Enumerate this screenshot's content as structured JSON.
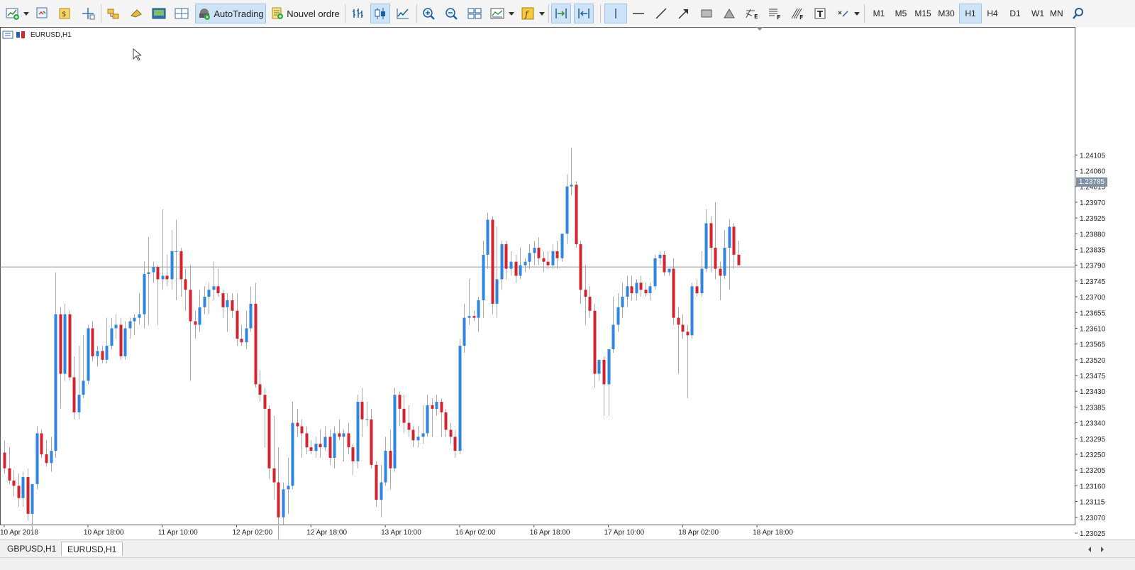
{
  "toolbar": {
    "autotrading_label": "AutoTrading",
    "new_order_label": "Nouvel ordre",
    "timeframes": [
      "M1",
      "M5",
      "M15",
      "M30",
      "H1",
      "H4",
      "D1",
      "W1",
      "MN"
    ],
    "active_timeframe": "H1",
    "icons": [
      "new-chart-icon",
      "profiles-icon",
      "market-watch-icon",
      "data-window-icon",
      "navigator-icon",
      "terminal-icon",
      "strategy-tester-icon",
      "autotrading-icon",
      "new-order-icon",
      "bar-chart-icon",
      "candlestick-icon",
      "line-chart-icon",
      "zoom-in-icon",
      "zoom-out-icon",
      "tile-windows-icon",
      "periods-icon",
      "indicators-icon",
      "chart-shift-icon",
      "auto-scroll-icon",
      "crosshair-icon",
      "vertical-line-icon",
      "horizontal-line-icon",
      "trendline-icon",
      "arrow-icon",
      "rectangle-icon",
      "triangle-icon",
      "fibonacci-expansion-icon",
      "fibonacci-fan-icon",
      "text-icon",
      "more-objects-icon",
      "search-icon"
    ]
  },
  "chart": {
    "title": "EURUSD,H1",
    "current_price_label": "1.23785"
  },
  "tabs": [
    "GBPUSD,H1",
    "EURUSD,H1"
  ],
  "active_tab": "EURUSD,H1",
  "colors": {
    "bull": "#2f86e0",
    "bear": "#d4232e",
    "wick": "#a8a8a8",
    "bidline": "#8a96a8"
  },
  "chart_data": {
    "type": "candlestick",
    "symbol": "EURUSD",
    "timeframe": "H1",
    "ylim": [
      1.23,
      1.2413
    ],
    "y_ticks": [
      "1.24105",
      "1.24060",
      "1.24015",
      "1.23970",
      "1.23925",
      "1.23880",
      "1.23835",
      "1.23790",
      "1.23745",
      "1.23700",
      "1.23655",
      "1.23610",
      "1.23565",
      "1.23520",
      "1.23475",
      "1.23430",
      "1.23385",
      "1.23340",
      "1.23295",
      "1.23250",
      "1.23205",
      "1.23160",
      "1.23115",
      "1.23070",
      "1.23025"
    ],
    "x_ticks": [
      {
        "label": "10 Apr 2018",
        "index": 0
      },
      {
        "label": "10 Apr 18:00",
        "index": 18
      },
      {
        "label": "11 Apr 10:00",
        "index": 34
      },
      {
        "label": "12 Apr 02:00",
        "index": 50
      },
      {
        "label": "12 Apr 18:00",
        "index": 66
      },
      {
        "label": "13 Apr 10:00",
        "index": 82
      },
      {
        "label": "16 Apr 02:00",
        "index": 98
      },
      {
        "label": "16 Apr 18:00",
        "index": 114
      },
      {
        "label": "17 Apr 10:00",
        "index": 130
      },
      {
        "label": "18 Apr 02:00",
        "index": 146
      },
      {
        "label": "18 Apr 18:00",
        "index": 162
      }
    ],
    "current_price": 1.23785,
    "candles": [
      [
        1.23255,
        1.2329,
        1.23195,
        1.2321
      ],
      [
        1.2321,
        1.2327,
        1.23165,
        1.23175
      ],
      [
        1.23175,
        1.23205,
        1.2313,
        1.2316
      ],
      [
        1.2316,
        1.23195,
        1.231,
        1.23125
      ],
      [
        1.23125,
        1.232,
        1.231,
        1.23185
      ],
      [
        1.23185,
        1.2321,
        1.2306,
        1.2308
      ],
      [
        1.2308,
        1.2316,
        1.2303,
        1.23165
      ],
      [
        1.23165,
        1.2333,
        1.2315,
        1.2331
      ],
      [
        1.2331,
        1.2332,
        1.2324,
        1.2325
      ],
      [
        1.2325,
        1.2329,
        1.23215,
        1.23225
      ],
      [
        1.23225,
        1.233,
        1.232,
        1.2326
      ],
      [
        1.2326,
        1.2377,
        1.2324,
        1.2365
      ],
      [
        1.2365,
        1.2367,
        1.2338,
        1.2348
      ],
      [
        1.2348,
        1.2368,
        1.2346,
        1.2365
      ],
      [
        1.2365,
        1.2366,
        1.2346,
        1.2347
      ],
      [
        1.2347,
        1.2353,
        1.2335,
        1.2337
      ],
      [
        1.2337,
        1.2356,
        1.2335,
        1.2342
      ],
      [
        1.2342,
        1.2359,
        1.2341,
        1.2346
      ],
      [
        1.2346,
        1.2362,
        1.2345,
        1.2361
      ],
      [
        1.2361,
        1.2363,
        1.23515,
        1.2353
      ],
      [
        1.2353,
        1.2356,
        1.235,
        1.23545
      ],
      [
        1.23545,
        1.2356,
        1.2351,
        1.2352
      ],
      [
        1.2352,
        1.2364,
        1.2351,
        1.2356
      ],
      [
        1.2356,
        1.2364,
        1.2355,
        1.2361
      ],
      [
        1.2361,
        1.2365,
        1.2358,
        1.2362
      ],
      [
        1.2362,
        1.2364,
        1.2352,
        1.2353
      ],
      [
        1.2353,
        1.2363,
        1.2352,
        1.2361
      ],
      [
        1.2361,
        1.2364,
        1.2358,
        1.2363
      ],
      [
        1.2363,
        1.2365,
        1.2359,
        1.2364
      ],
      [
        1.2364,
        1.2371,
        1.2362,
        1.2365
      ],
      [
        1.2365,
        1.238,
        1.2361,
        1.23765
      ],
      [
        1.23765,
        1.2387,
        1.2362,
        1.2377
      ],
      [
        1.2377,
        1.238,
        1.2374,
        1.23785
      ],
      [
        1.23785,
        1.2379,
        1.2362,
        1.2375
      ],
      [
        1.2375,
        1.2395,
        1.2372,
        1.2376
      ],
      [
        1.2376,
        1.2382,
        1.2373,
        1.2375
      ],
      [
        1.2375,
        1.2389,
        1.2372,
        1.2383
      ],
      [
        1.2383,
        1.2392,
        1.2369,
        1.2383
      ],
      [
        1.2383,
        1.2384,
        1.237,
        1.2375
      ],
      [
        1.2375,
        1.2378,
        1.2366,
        1.2372
      ],
      [
        1.2372,
        1.2379,
        1.2346,
        1.2363
      ],
      [
        1.2363,
        1.2366,
        1.2358,
        1.2362
      ],
      [
        1.2362,
        1.2372,
        1.236,
        1.2367
      ],
      [
        1.2367,
        1.2373,
        1.2365,
        1.237
      ],
      [
        1.237,
        1.2374,
        1.2365,
        1.2372
      ],
      [
        1.2372,
        1.238,
        1.2369,
        1.2373
      ],
      [
        1.2373,
        1.2378,
        1.237,
        1.2371
      ],
      [
        1.2371,
        1.2372,
        1.2364,
        1.2367
      ],
      [
        1.2367,
        1.2371,
        1.236,
        1.2369
      ],
      [
        1.2369,
        1.2371,
        1.2364,
        1.2366
      ],
      [
        1.2366,
        1.2371,
        1.2356,
        1.2358
      ],
      [
        1.2358,
        1.2362,
        1.2356,
        1.2357
      ],
      [
        1.2357,
        1.2366,
        1.2355,
        1.2361
      ],
      [
        1.2361,
        1.2373,
        1.236,
        1.2368
      ],
      [
        1.2368,
        1.2374,
        1.2344,
        1.2345
      ],
      [
        1.2345,
        1.2349,
        1.234,
        1.2342
      ],
      [
        1.2342,
        1.2344,
        1.2327,
        1.2338
      ],
      [
        1.2338,
        1.2339,
        1.2318,
        1.2321
      ],
      [
        1.2321,
        1.2336,
        1.2312,
        1.2317
      ],
      [
        1.2317,
        1.2327,
        1.23,
        1.2307
      ],
      [
        1.2307,
        1.2317,
        1.2305,
        1.2315
      ],
      [
        1.2315,
        1.2324,
        1.2308,
        1.2316
      ],
      [
        1.2316,
        1.234,
        1.2315,
        1.2334
      ],
      [
        1.2334,
        1.2338,
        1.233,
        1.2333
      ],
      [
        1.2333,
        1.2335,
        1.2324,
        1.2331
      ],
      [
        1.2331,
        1.2333,
        1.2325,
        1.2327
      ],
      [
        1.2327,
        1.2329,
        1.2325,
        1.2326
      ],
      [
        1.2326,
        1.233,
        1.2324,
        1.2328
      ],
      [
        1.2328,
        1.2332,
        1.2324,
        1.2327
      ],
      [
        1.2327,
        1.2333,
        1.2326,
        1.233
      ],
      [
        1.233,
        1.2332,
        1.2322,
        1.2324
      ],
      [
        1.2324,
        1.2333,
        1.2321,
        1.2331
      ],
      [
        1.2331,
        1.2335,
        1.2329,
        1.233
      ],
      [
        1.233,
        1.2332,
        1.2323,
        1.2331
      ],
      [
        1.2331,
        1.2334,
        1.2325,
        1.2327
      ],
      [
        1.2327,
        1.2328,
        1.2319,
        1.2323
      ],
      [
        1.2323,
        1.2342,
        1.2321,
        1.234
      ],
      [
        1.234,
        1.2344,
        1.233,
        1.2335
      ],
      [
        1.2335,
        1.234,
        1.2333,
        1.2335
      ],
      [
        1.2335,
        1.2338,
        1.2321,
        1.2322
      ],
      [
        1.2322,
        1.2323,
        1.231,
        1.2312
      ],
      [
        1.2312,
        1.2322,
        1.2307,
        1.2317
      ],
      [
        1.2317,
        1.233,
        1.2316,
        1.2326
      ],
      [
        1.2326,
        1.2332,
        1.2315,
        1.2321
      ],
      [
        1.2321,
        1.2344,
        1.232,
        1.2342
      ],
      [
        1.2342,
        1.2343,
        1.2333,
        1.2338
      ],
      [
        1.2338,
        1.2342,
        1.2331,
        1.2334
      ],
      [
        1.2334,
        1.2339,
        1.233,
        1.2332
      ],
      [
        1.2332,
        1.2333,
        1.2327,
        1.2329
      ],
      [
        1.2329,
        1.2333,
        1.2327,
        1.233
      ],
      [
        1.233,
        1.2339,
        1.2328,
        1.2331
      ],
      [
        1.2331,
        1.2342,
        1.233,
        1.2339
      ],
      [
        1.2339,
        1.2341,
        1.233,
        1.2338
      ],
      [
        1.2338,
        1.2342,
        1.2336,
        1.234
      ],
      [
        1.234,
        1.2341,
        1.233,
        1.2337
      ],
      [
        1.2337,
        1.2338,
        1.233,
        1.2332
      ],
      [
        1.2332,
        1.2334,
        1.2328,
        1.233
      ],
      [
        1.233,
        1.2332,
        1.2324,
        1.2326
      ],
      [
        1.2326,
        1.2358,
        1.2325,
        1.2356
      ],
      [
        1.2356,
        1.2368,
        1.2354,
        1.2364
      ],
      [
        1.2364,
        1.2375,
        1.2362,
        1.23645
      ],
      [
        1.23645,
        1.2366,
        1.2363,
        1.2364
      ],
      [
        1.2364,
        1.237,
        1.236,
        1.2369
      ],
      [
        1.2369,
        1.2386,
        1.2364,
        1.2382
      ],
      [
        1.2382,
        1.2394,
        1.2378,
        1.2392
      ],
      [
        1.2392,
        1.2393,
        1.2365,
        1.2368
      ],
      [
        1.2368,
        1.239,
        1.2364,
        1.2375
      ],
      [
        1.2375,
        1.2386,
        1.2372,
        1.2385
      ],
      [
        1.2385,
        1.2386,
        1.2375,
        1.2378
      ],
      [
        1.2378,
        1.2383,
        1.2376,
        1.238
      ],
      [
        1.238,
        1.2382,
        1.2374,
        1.2376
      ],
      [
        1.2376,
        1.2384,
        1.2375,
        1.2379
      ],
      [
        1.2379,
        1.2381,
        1.2377,
        1.238
      ],
      [
        1.238,
        1.2385,
        1.2378,
        1.23825
      ],
      [
        1.23825,
        1.2386,
        1.2379,
        1.2384
      ],
      [
        1.2384,
        1.2387,
        1.2379,
        1.2381
      ],
      [
        1.2381,
        1.2383,
        1.2377,
        1.238
      ],
      [
        1.238,
        1.2383,
        1.2378,
        1.2379
      ],
      [
        1.2379,
        1.2385,
        1.2378,
        1.2383
      ],
      [
        1.2383,
        1.2386,
        1.2378,
        1.2381
      ],
      [
        1.2381,
        1.2388,
        1.238,
        1.2388
      ],
      [
        1.2388,
        1.2405,
        1.2385,
        1.24015
      ],
      [
        1.24015,
        1.24125,
        1.2399,
        1.2402
      ],
      [
        1.2402,
        1.2403,
        1.2384,
        1.2385
      ],
      [
        1.2385,
        1.2386,
        1.2368,
        1.2372
      ],
      [
        1.2372,
        1.2379,
        1.2362,
        1.237
      ],
      [
        1.237,
        1.2373,
        1.2364,
        1.2366
      ],
      [
        1.2366,
        1.2368,
        1.2344,
        1.2348
      ],
      [
        1.2348,
        1.2352,
        1.2346,
        1.2352
      ],
      [
        1.2352,
        1.2353,
        1.2336,
        1.2345
      ],
      [
        1.2345,
        1.2353,
        1.2336,
        1.2355
      ],
      [
        1.2355,
        1.237,
        1.2354,
        1.2362
      ],
      [
        1.2362,
        1.2371,
        1.236,
        1.2367
      ],
      [
        1.2367,
        1.2374,
        1.2364,
        1.237
      ],
      [
        1.237,
        1.2376,
        1.2367,
        1.2373
      ],
      [
        1.2373,
        1.2376,
        1.2369,
        1.2371
      ],
      [
        1.2371,
        1.2375,
        1.2369,
        1.2374
      ],
      [
        1.2374,
        1.2376,
        1.237,
        1.2372
      ],
      [
        1.2372,
        1.2374,
        1.237,
        1.2371
      ],
      [
        1.2371,
        1.2374,
        1.2369,
        1.2373
      ],
      [
        1.2373,
        1.2382,
        1.2372,
        1.2381
      ],
      [
        1.2381,
        1.2383,
        1.2379,
        1.2382
      ],
      [
        1.2382,
        1.2383,
        1.2376,
        1.2377
      ],
      [
        1.2377,
        1.2378,
        1.2376,
        1.2378
      ],
      [
        1.2378,
        1.2381,
        1.2362,
        1.2364
      ],
      [
        1.2364,
        1.2367,
        1.2348,
        1.2362
      ],
      [
        1.2362,
        1.2365,
        1.2358,
        1.236
      ],
      [
        1.236,
        1.2362,
        1.2341,
        1.2359
      ],
      [
        1.2359,
        1.2374,
        1.2358,
        1.2373
      ],
      [
        1.2373,
        1.2375,
        1.237,
        1.2371
      ],
      [
        1.2371,
        1.2383,
        1.237,
        1.2378
      ],
      [
        1.2378,
        1.2395,
        1.2377,
        1.2391
      ],
      [
        1.2391,
        1.2393,
        1.2377,
        1.2384
      ],
      [
        1.2384,
        1.2397,
        1.2375,
        1.2378
      ],
      [
        1.2378,
        1.238,
        1.2369,
        1.2376
      ],
      [
        1.2376,
        1.2389,
        1.2375,
        1.2384
      ],
      [
        1.2384,
        1.2392,
        1.2372,
        1.239
      ],
      [
        1.239,
        1.2391,
        1.2378,
        1.2382
      ],
      [
        1.2382,
        1.2386,
        1.2379,
        1.2379
      ]
    ]
  }
}
